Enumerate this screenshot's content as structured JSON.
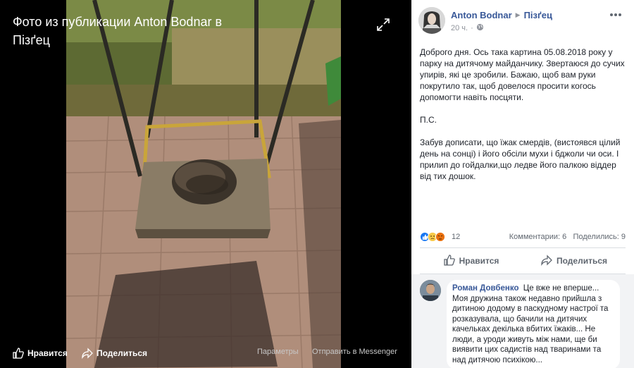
{
  "viewer": {
    "title": "Фото из публикации Anton Bodnar в Пізґец",
    "bottom": {
      "like_label": "Нравится",
      "share_label": "Поделиться",
      "options_label": "Параметры",
      "messenger_label": "Отправить в Messenger"
    }
  },
  "post": {
    "author": "Anton Bodnar",
    "group": "Пізґец",
    "time": "20 ч.",
    "paragraphs": [
      "Доброго дня. Ось така картина 05.08.2018 року у парку на дитячому майданчику. Звертаюся до сучих упирів, які це зробили. Бажаю, щоб вам руки покрутило так, щоб довелося просити когось допомогти навіть посцяти.",
      "П.С.",
      "Забув дописати, що їжак смердів, (вистоявся цілий день на сонці) і його обсіли мухи і бджоли чи оси. І прилип до гойдалки,що ледве його палкою віддер від тих дошок."
    ],
    "reactions": {
      "count": "12",
      "comments": "Комментарии: 6",
      "shares": "Поделились: 9"
    },
    "actions": {
      "like_label": "Нравится",
      "share_label": "Поделиться"
    }
  },
  "comments": [
    {
      "author": "Роман Довбенко",
      "text": "Це вже не вперше... Моя дружина також недавно прийшла з дитиною додому в паскудному настрої та розказувала, що бачили на дитячих качельках декілька вбитих їжаків... Не люди, а уроди живуть між нами, ще би виявити цих садистів над тваринами та над дитячою психікою..."
    }
  ],
  "colors": {
    "link": "#385898",
    "meta": "#90949c",
    "text": "#1d2129",
    "panel_bg": "#ffffff",
    "comment_bg": "#f2f3f5"
  },
  "icons": [
    "expand-icon",
    "like-icon",
    "share-icon",
    "globe-icon",
    "more-icon",
    "reaction-like-icon",
    "reaction-sad-icon",
    "reaction-angry-icon"
  ]
}
